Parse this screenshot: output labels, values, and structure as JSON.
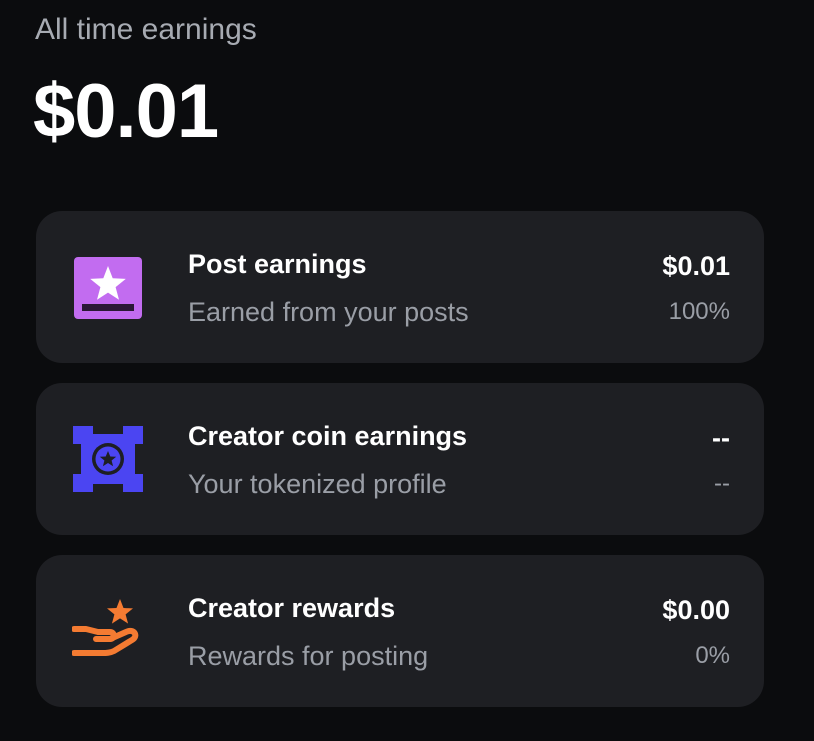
{
  "summary": {
    "label": "All time earnings",
    "amount": "$0.01"
  },
  "cards": [
    {
      "title": "Post earnings",
      "subtitle": "Earned from your posts",
      "value": "$0.01",
      "percent": "100%",
      "icon": "post-star-icon",
      "icon_color": "#c26cf0"
    },
    {
      "title": "Creator coin earnings",
      "subtitle": "Your tokenized profile",
      "value": "--",
      "percent": "--",
      "icon": "creator-coin-icon",
      "icon_color": "#4b45f2"
    },
    {
      "title": "Creator rewards",
      "subtitle": "Rewards for posting",
      "value": "$0.00",
      "percent": "0%",
      "icon": "reward-hand-star-icon",
      "icon_color": "#f47b32"
    }
  ]
}
